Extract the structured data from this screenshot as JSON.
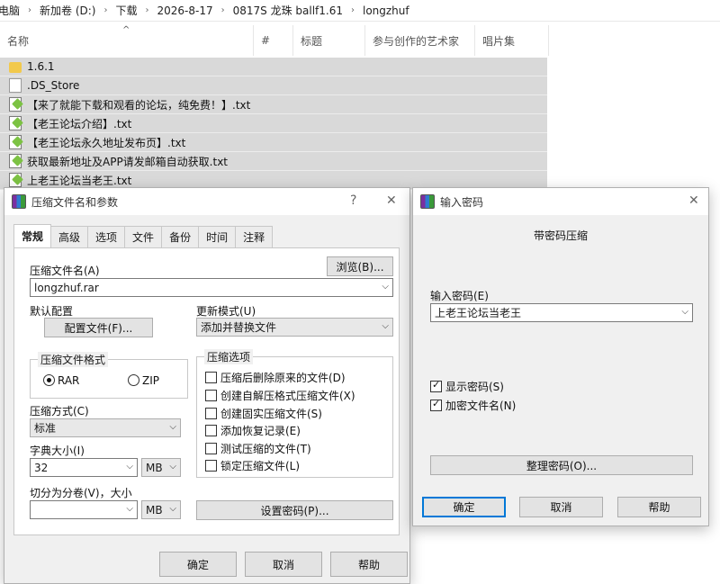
{
  "breadcrumb": [
    "电脑",
    "新加卷 (D:)",
    "下载",
    "2026-8-17",
    "0817S 龙珠 ballf1.61",
    "longzhuf"
  ],
  "columns": {
    "name": "名称",
    "number": "#",
    "title": "标题",
    "artist": "参与创作的艺术家",
    "album": "唱片集"
  },
  "files": [
    {
      "name": "1.6.1",
      "icon": "folder-icon"
    },
    {
      "name": ".DS_Store",
      "icon": "file-icon"
    },
    {
      "name": "【来了就能下载和观看的论坛，纯免费！】.txt",
      "icon": "txt-icon"
    },
    {
      "name": "【老王论坛介绍】.txt",
      "icon": "txt-icon"
    },
    {
      "name": "【老王论坛永久地址发布页】.txt",
      "icon": "txt-icon"
    },
    {
      "name": "获取最新地址及APP请发邮箱自动获取.txt",
      "icon": "txt-icon"
    },
    {
      "name": "上老王论坛当老王.txt",
      "icon": "txt-icon"
    }
  ],
  "archive_dialog": {
    "title": "压缩文件名和参数",
    "help_btn": "?",
    "close_btn": "✕",
    "tabs": [
      "常规",
      "高级",
      "选项",
      "文件",
      "备份",
      "时间",
      "注释"
    ],
    "archive_name_label": "压缩文件名(A)",
    "archive_name_value": "longzhuf.rar",
    "browse_btn": "浏览(B)...",
    "default_profile_label": "默认配置",
    "profiles_btn": "配置文件(F)...",
    "update_mode_label": "更新模式(U)",
    "update_mode_value": "添加并替换文件",
    "format_group": "压缩文件格式",
    "format_rar": "RAR",
    "format_zip": "ZIP",
    "method_label": "压缩方式(C)",
    "method_value": "标准",
    "dict_label": "字典大小(I)",
    "dict_value": "32",
    "dict_unit": "MB",
    "split_label": "切分为分卷(V)，大小",
    "split_value": "",
    "split_unit": "MB",
    "options_group": "压缩选项",
    "options": [
      {
        "label": "压缩后删除原来的文件(D)",
        "checked": false
      },
      {
        "label": "创建自解压格式压缩文件(X)",
        "checked": false
      },
      {
        "label": "创建固实压缩文件(S)",
        "checked": false
      },
      {
        "label": "添加恢复记录(E)",
        "checked": false
      },
      {
        "label": "测试压缩的文件(T)",
        "checked": false
      },
      {
        "label": "锁定压缩文件(L)",
        "checked": false
      }
    ],
    "set_password_btn": "设置密码(P)...",
    "ok_btn": "确定",
    "cancel_btn": "取消",
    "help_btn_label": "帮助"
  },
  "password_dialog": {
    "title": "输入密码",
    "close_btn": "✕",
    "heading": "带密码压缩",
    "password_label": "输入密码(E)",
    "password_value": "上老王论坛当老王",
    "show_password": "显示密码(S)",
    "show_password_checked": true,
    "encrypt_names": "加密文件名(N)",
    "encrypt_names_checked": true,
    "organize_btn": "整理密码(O)...",
    "ok_btn": "确定",
    "cancel_btn": "取消",
    "help_btn": "帮助"
  }
}
